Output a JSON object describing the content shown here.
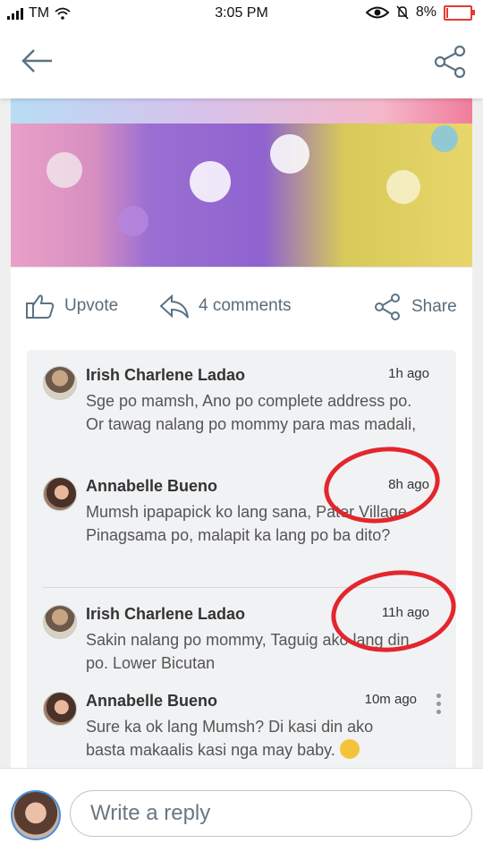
{
  "status_bar": {
    "carrier": "TM",
    "time": "3:05 PM",
    "battery_percent": "8%",
    "battery_level": 0.08,
    "battery_color": "#e53935"
  },
  "app_bar": {
    "back_icon": "arrow-left-icon",
    "share_icon": "share-icon"
  },
  "post": {
    "actions": {
      "upvote_label": "Upvote",
      "comments_label": "4 comments",
      "share_label": "Share"
    }
  },
  "comments": [
    {
      "author": "Irish Charlene Ladao",
      "time": "1h ago",
      "text": "Sge po mamsh, Ano po complete address po. Or tawag nalang po mommy para mas madali, lower bicutan lang namansi ako."
    },
    {
      "author": "Annabelle Bueno",
      "time": "8h ago",
      "text": "Mumsh ipapapick ko lang sana, Pater Village Pinagsama po, malapit ka lang po ba dito?"
    },
    {
      "author": "Irish Charlene Ladao",
      "time": "11h ago",
      "text": "Sakin nalang po mommy, Taguig ako lang din po. Lower Bicutan"
    },
    {
      "author": "Annabelle Bueno",
      "time": "10m ago",
      "text": "Sure ka ok lang Mumsh? Di kasi din ako basta makaalis kasi nga may baby."
    }
  ],
  "reply": {
    "placeholder": "Write a reply"
  },
  "colors": {
    "annotation_circle": "#e3262d",
    "accent_text": "#5a6b7a"
  }
}
